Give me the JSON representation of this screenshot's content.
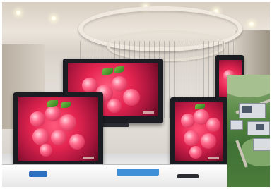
{
  "photo": {
    "scene": "showroom-display",
    "icons": [
      "ceiling-light",
      "tv-screen",
      "aerial-inset"
    ]
  }
}
